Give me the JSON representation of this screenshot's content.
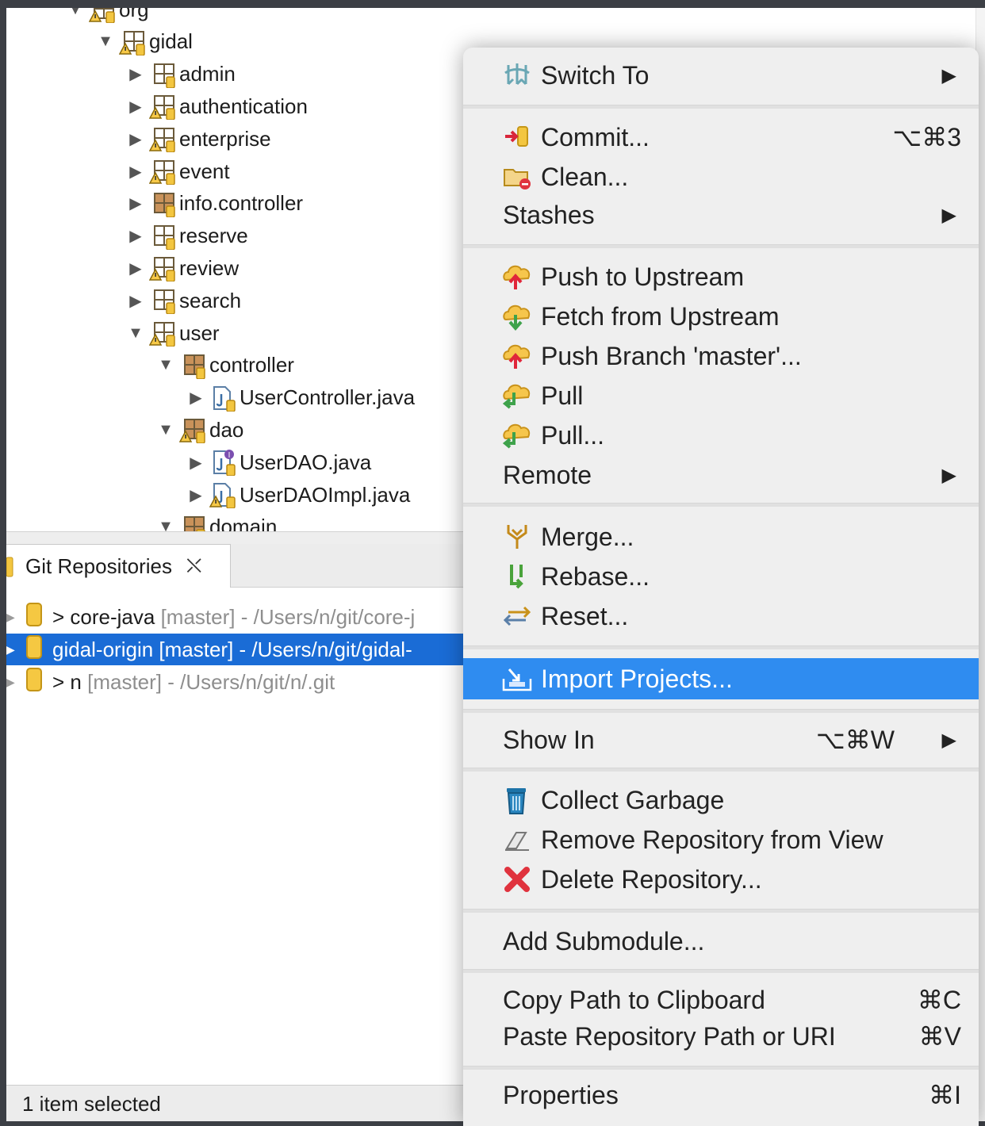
{
  "tree": {
    "items": [
      {
        "label": "org",
        "indent": 0,
        "expanded": true,
        "icon": "package-warning-icon"
      },
      {
        "label": "gidal",
        "indent": 1,
        "expanded": true,
        "icon": "package-warning-icon"
      },
      {
        "label": "admin",
        "indent": 2,
        "expanded": false,
        "icon": "package-icon"
      },
      {
        "label": "authentication",
        "indent": 2,
        "expanded": false,
        "icon": "package-warning-icon"
      },
      {
        "label": "enterprise",
        "indent": 2,
        "expanded": false,
        "icon": "package-warning-icon"
      },
      {
        "label": "event",
        "indent": 2,
        "expanded": false,
        "icon": "package-warning-icon"
      },
      {
        "label": "info.controller",
        "indent": 2,
        "expanded": false,
        "icon": "package-filled-icon"
      },
      {
        "label": "reserve",
        "indent": 2,
        "expanded": false,
        "icon": "package-icon"
      },
      {
        "label": "review",
        "indent": 2,
        "expanded": false,
        "icon": "package-warning-icon"
      },
      {
        "label": "search",
        "indent": 2,
        "expanded": false,
        "icon": "package-icon"
      },
      {
        "label": "user",
        "indent": 2,
        "expanded": true,
        "icon": "package-warning-icon"
      },
      {
        "label": "controller",
        "indent": 3,
        "expanded": true,
        "icon": "package-filled-icon"
      },
      {
        "label": "UserController.java",
        "indent": 4,
        "expanded": false,
        "icon": "java-file-icon"
      },
      {
        "label": "dao",
        "indent": 3,
        "expanded": true,
        "icon": "package-filled-warning-icon"
      },
      {
        "label": "UserDAO.java",
        "indent": 4,
        "expanded": false,
        "icon": "java-interface-icon"
      },
      {
        "label": "UserDAOImpl.java",
        "indent": 4,
        "expanded": false,
        "icon": "java-file-warning-icon"
      },
      {
        "label": "domain",
        "indent": 3,
        "expanded": true,
        "icon": "package-filled-icon"
      }
    ]
  },
  "git_view": {
    "tab_label": "Git Repositories",
    "repos": [
      {
        "prefix": "> ",
        "name": "core-java",
        "branch": " [master]",
        "path": " - /Users/n/git/core-j",
        "selected": false
      },
      {
        "prefix": "",
        "name": "gidal-origin",
        "branch": " [master]",
        "path": " - /Users/n/git/gidal-",
        "selected": true
      },
      {
        "prefix": "> ",
        "name": "n",
        "branch": " [master]",
        "path": " - /Users/n/git/n/.git",
        "selected": false
      }
    ]
  },
  "status": {
    "text": "1 item selected"
  },
  "menu": {
    "highlight_color": "#2f8cf0",
    "items": {
      "switch_to": {
        "label": "Switch To",
        "icon": "switch-branch-icon"
      },
      "commit": {
        "label": "Commit...",
        "shortcut": "⌥⌘3",
        "icon": "commit-icon"
      },
      "clean": {
        "label": "Clean...",
        "icon": "clean-icon"
      },
      "stashes": {
        "label": "Stashes"
      },
      "push_upstream": {
        "label": "Push to Upstream",
        "icon": "push-icon"
      },
      "fetch_upstream": {
        "label": "Fetch from Upstream",
        "icon": "fetch-icon"
      },
      "push_branch": {
        "label": "Push Branch 'master'...",
        "icon": "push-icon"
      },
      "pull": {
        "label": "Pull",
        "icon": "pull-icon"
      },
      "pull_dialog": {
        "label": "Pull...",
        "icon": "pull-icon"
      },
      "remote": {
        "label": "Remote"
      },
      "merge": {
        "label": "Merge...",
        "icon": "merge-icon"
      },
      "rebase": {
        "label": "Rebase...",
        "icon": "rebase-icon"
      },
      "reset": {
        "label": "Reset...",
        "icon": "reset-icon"
      },
      "import_projects": {
        "label": "Import Projects...",
        "icon": "import-icon"
      },
      "show_in": {
        "label": "Show In",
        "shortcut": "⌥⌘W"
      },
      "collect_garbage": {
        "label": "Collect Garbage",
        "icon": "trash-icon"
      },
      "remove_repo": {
        "label": "Remove Repository from View",
        "icon": "eraser-icon"
      },
      "delete_repo": {
        "label": "Delete Repository...",
        "icon": "delete-icon"
      },
      "add_submodule": {
        "label": "Add Submodule..."
      },
      "copy_path": {
        "label": "Copy Path to Clipboard",
        "shortcut": "⌘C"
      },
      "paste_path": {
        "label": "Paste Repository Path or URI",
        "shortcut": "⌘V"
      },
      "properties": {
        "label": "Properties",
        "shortcut": "⌘I"
      }
    }
  }
}
